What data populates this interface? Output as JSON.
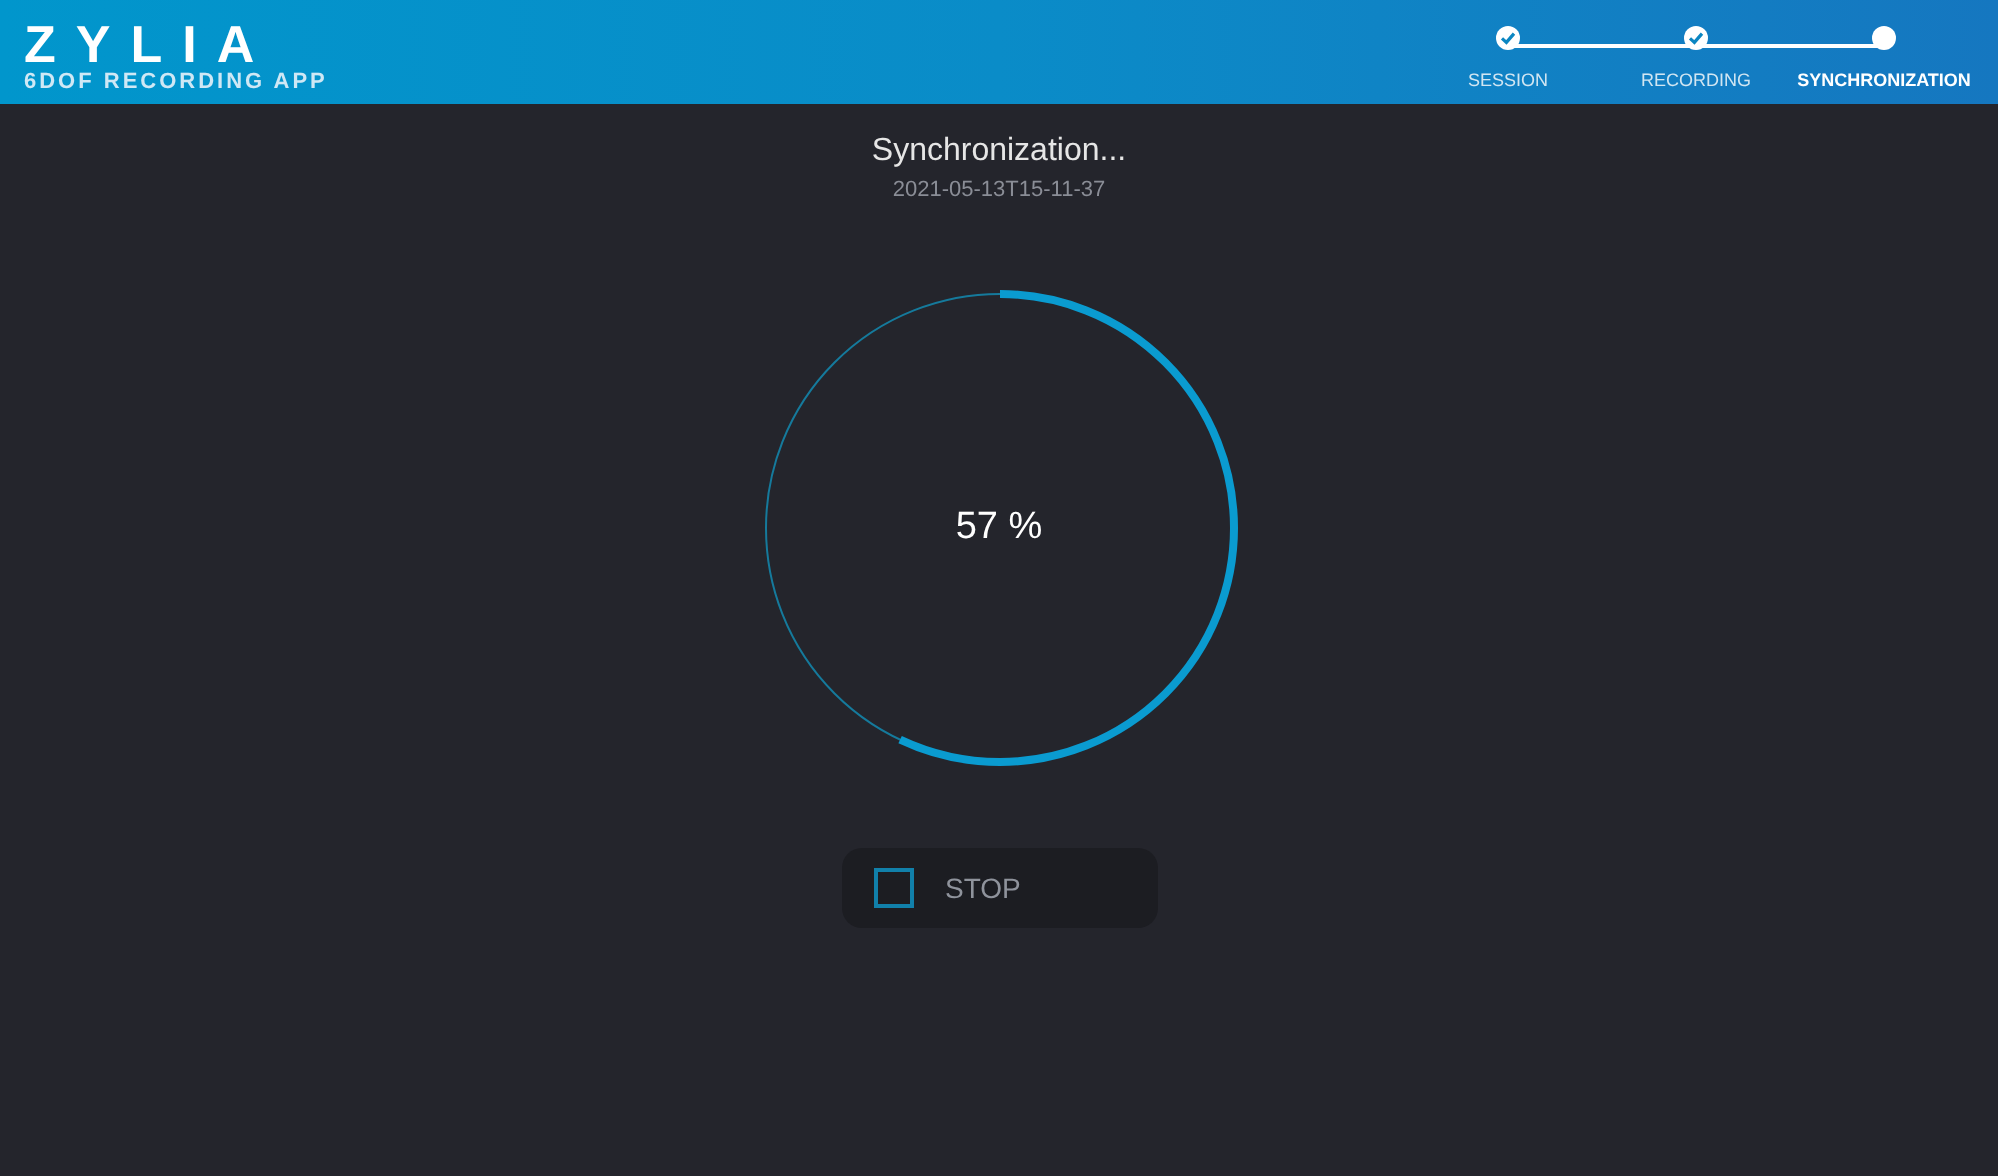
{
  "header": {
    "logo": "ZYLIA",
    "subtitle": "6DOF RECORDING APP"
  },
  "steps": [
    {
      "label": "SESSION",
      "done": true,
      "selected": false
    },
    {
      "label": "RECORDING",
      "done": true,
      "selected": false
    },
    {
      "label": "SYNCHRONIZATION",
      "done": false,
      "selected": true
    }
  ],
  "title": "Synchronization...",
  "timestamp": "2021-05-13T15-11-37",
  "progress": {
    "level": 0.57,
    "reading": "57 %"
  },
  "stop_button": {
    "label": "STOP"
  }
}
